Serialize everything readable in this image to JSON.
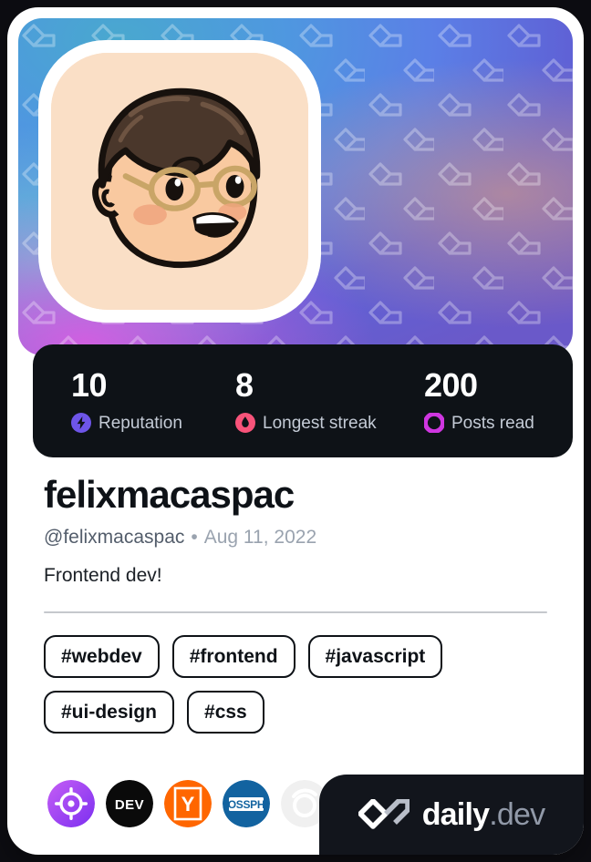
{
  "card": {
    "background_color": "#ffffff",
    "cover_gradient_colors": [
      "#49a8cf",
      "#4f97e0",
      "#5b7fe6",
      "#5f62d6",
      "#6a59c9",
      "#d85ce2",
      "#eca678"
    ]
  },
  "avatar": {
    "name": "avatar-illustration",
    "alt": "Cartoon portrait of a person with brown hair and round glasses smiling",
    "frame_color": "#ffffff",
    "background_color": "#fadfc6"
  },
  "stats": {
    "background_color": "#0e1217",
    "items": [
      {
        "value": "10",
        "label": "Reputation",
        "icon": "reputation-bolt-icon",
        "color": "#6e55e8"
      },
      {
        "value": "8",
        "label": "Longest streak",
        "icon": "streak-flame-icon",
        "color": "#f8537a"
      },
      {
        "value": "200",
        "label": "Posts read",
        "icon": "posts-read-ring-icon",
        "color": "#cf36e0"
      }
    ]
  },
  "profile": {
    "display_name": "felixmacaspac",
    "handle": "@felixmacaspac",
    "separator": "•",
    "joined_date": "Aug 11, 2022",
    "bio": "Frontend dev!"
  },
  "tags": [
    {
      "label": "#webdev"
    },
    {
      "label": "#frontend"
    },
    {
      "label": "#javascript"
    },
    {
      "label": "#ui-design"
    },
    {
      "label": "#css"
    }
  ],
  "badges": [
    {
      "name": "target-badge",
      "title": "Target",
      "color": "#a855f7"
    },
    {
      "name": "dev-to-badge",
      "title": "DEV",
      "color": "#0a0a0a",
      "text": "DEV"
    },
    {
      "name": "hacker-news-badge",
      "title": "Y Combinator",
      "color": "#ff6600",
      "text": "Y"
    },
    {
      "name": "ossph-badge",
      "title": "OSSPH",
      "color": "#1263a0",
      "text": "OSSPH"
    },
    {
      "name": "hidden-source-badge",
      "title": "",
      "color": "#d8d8d8"
    }
  ],
  "brand": {
    "name_primary": "daily",
    "name_secondary": ".dev",
    "background_color": "#12151c",
    "primary_color": "#ffffff",
    "secondary_color": "#9199a8"
  }
}
